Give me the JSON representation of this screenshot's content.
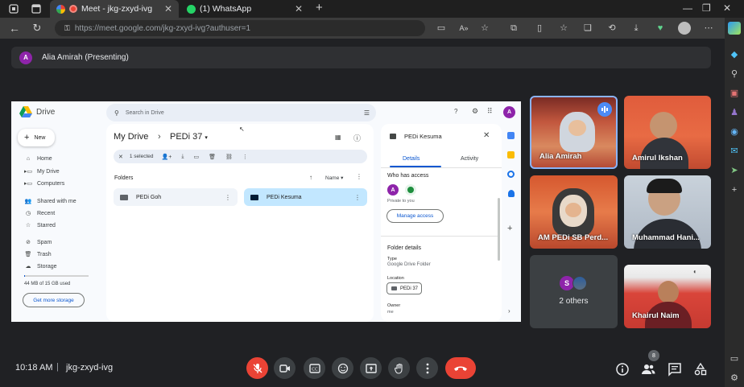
{
  "browser": {
    "tabs": [
      {
        "title": "Meet - jkg-zxyd-ivg",
        "active": true
      },
      {
        "title": "(1) WhatsApp",
        "active": false
      }
    ],
    "url": "https://meet.google.com/jkg-zxyd-ivg?authuser=1"
  },
  "presenting": {
    "avatar_letter": "A",
    "label": "Alia Amirah (Presenting)"
  },
  "drive": {
    "brand": "Drive",
    "search_placeholder": "Search in Drive",
    "account_letter": "A",
    "new_label": "New",
    "nav": [
      "Home",
      "My Drive",
      "Computers",
      "Shared with me",
      "Recent",
      "Starred",
      "Spam",
      "Trash",
      "Storage"
    ],
    "storage_text": "44 MB of 15 GB used",
    "storage_fraction": 0.003,
    "get_storage_label": "Get more storage",
    "breadcrumb_root": "My Drive",
    "breadcrumb_sep": "›",
    "breadcrumb_current": "PEDi 37",
    "selected_label": "1 selected",
    "folders_heading": "Folders",
    "sort_label": "Name",
    "folders": [
      {
        "name": "PEDi Goh",
        "selected": false
      },
      {
        "name": "PEDi Kesuma",
        "selected": true
      }
    ],
    "details": {
      "title": "PEDi Kesuma",
      "tab_details": "Details",
      "tab_activity": "Activity",
      "access_heading": "Who has access",
      "access_avatar": "A",
      "private_text": "Private to you",
      "manage_label": "Manage access",
      "folder_details_heading": "Folder details",
      "type_label": "Type",
      "type_value": "Google Drive Folder",
      "location_label": "Location",
      "location_value": "PEDi 37",
      "owner_label": "Owner",
      "owner_value": "me"
    }
  },
  "tiles": [
    {
      "name": "Alia Amirah",
      "speaking": true
    },
    {
      "name": "Amirul Ikshan"
    },
    {
      "name": "AM PEDi SB Perd..."
    },
    {
      "name": "Muhammad Hani..."
    },
    {
      "name": "2 others",
      "avatar_letter": "S"
    },
    {
      "name": "Khairul Naim"
    }
  ],
  "bottom": {
    "time": "10:18 AM",
    "separator": "|",
    "meeting_code": "jkg-zxyd-ivg",
    "participants_count": "8"
  },
  "colors": {
    "meet_bg": "#202124",
    "end_call": "#ea4335",
    "drive_blue": "#0b57d0",
    "avatar_purple": "#8e24aa"
  }
}
